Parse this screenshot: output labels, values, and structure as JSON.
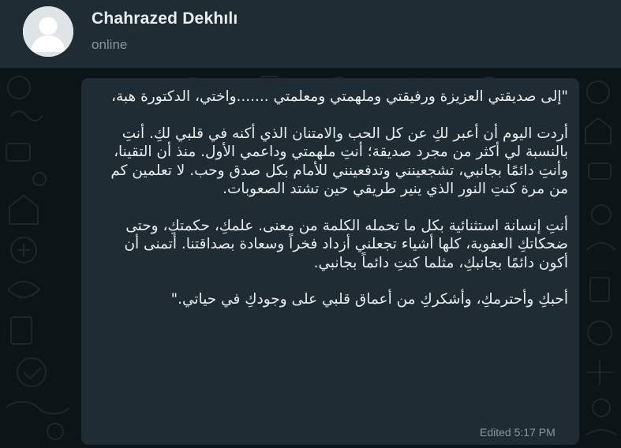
{
  "header": {
    "contact_name": "Chahrazed Dekhılı",
    "status": "online",
    "avatar_icon": "default-user-avatar"
  },
  "message": {
    "paragraphs": [
      "\"إلى صديقتي العزيزة ورفيقتي وملهمتي ومعلمتي .......واختي، الدكتورة هبة،",
      "أردت اليوم أن أعبر لكِ عن كل الحب والامتنان الذي أكنه في قلبي لكِ. أنتِ بالنسبة لي أكثر من مجرد صديقة؛ أنتِ ملهمتي وداعمي الأول. منذ أن التقينا، وأنتِ دائمًا بجانبي، تشجعينني وتدفعينني للأمام بكل صدق وحب. لا تعلمين كم من مرة كنتِ النور الذي ينير طريقي حين تشتد الصعوبات.",
      "أنتِ إنسانة استثنائية بكل ما تحمله الكلمة من معنى. علمكِ، حكمتكِ، وحتى ضحكاتكِ العفوية، كلها أشياء تجعلني أزداد فخراً وسعادة بصداقتنا. أتمنى أن أكون دائمًا بجانبكِ، مثلما كنتِ دائماً بجانبي.",
      "أحبكِ وأحترمكِ، وأشكركِ من أعماق قلبي على وجودكِ في حياتي.\""
    ],
    "edited_label": "Edited",
    "time": "5:17 PM"
  },
  "colors": {
    "header_bg": "#202c33",
    "chat_bg": "#0d1418",
    "bubble_bg": "#202c33",
    "text_primary": "#e9edef",
    "text_secondary": "#8696a0"
  }
}
